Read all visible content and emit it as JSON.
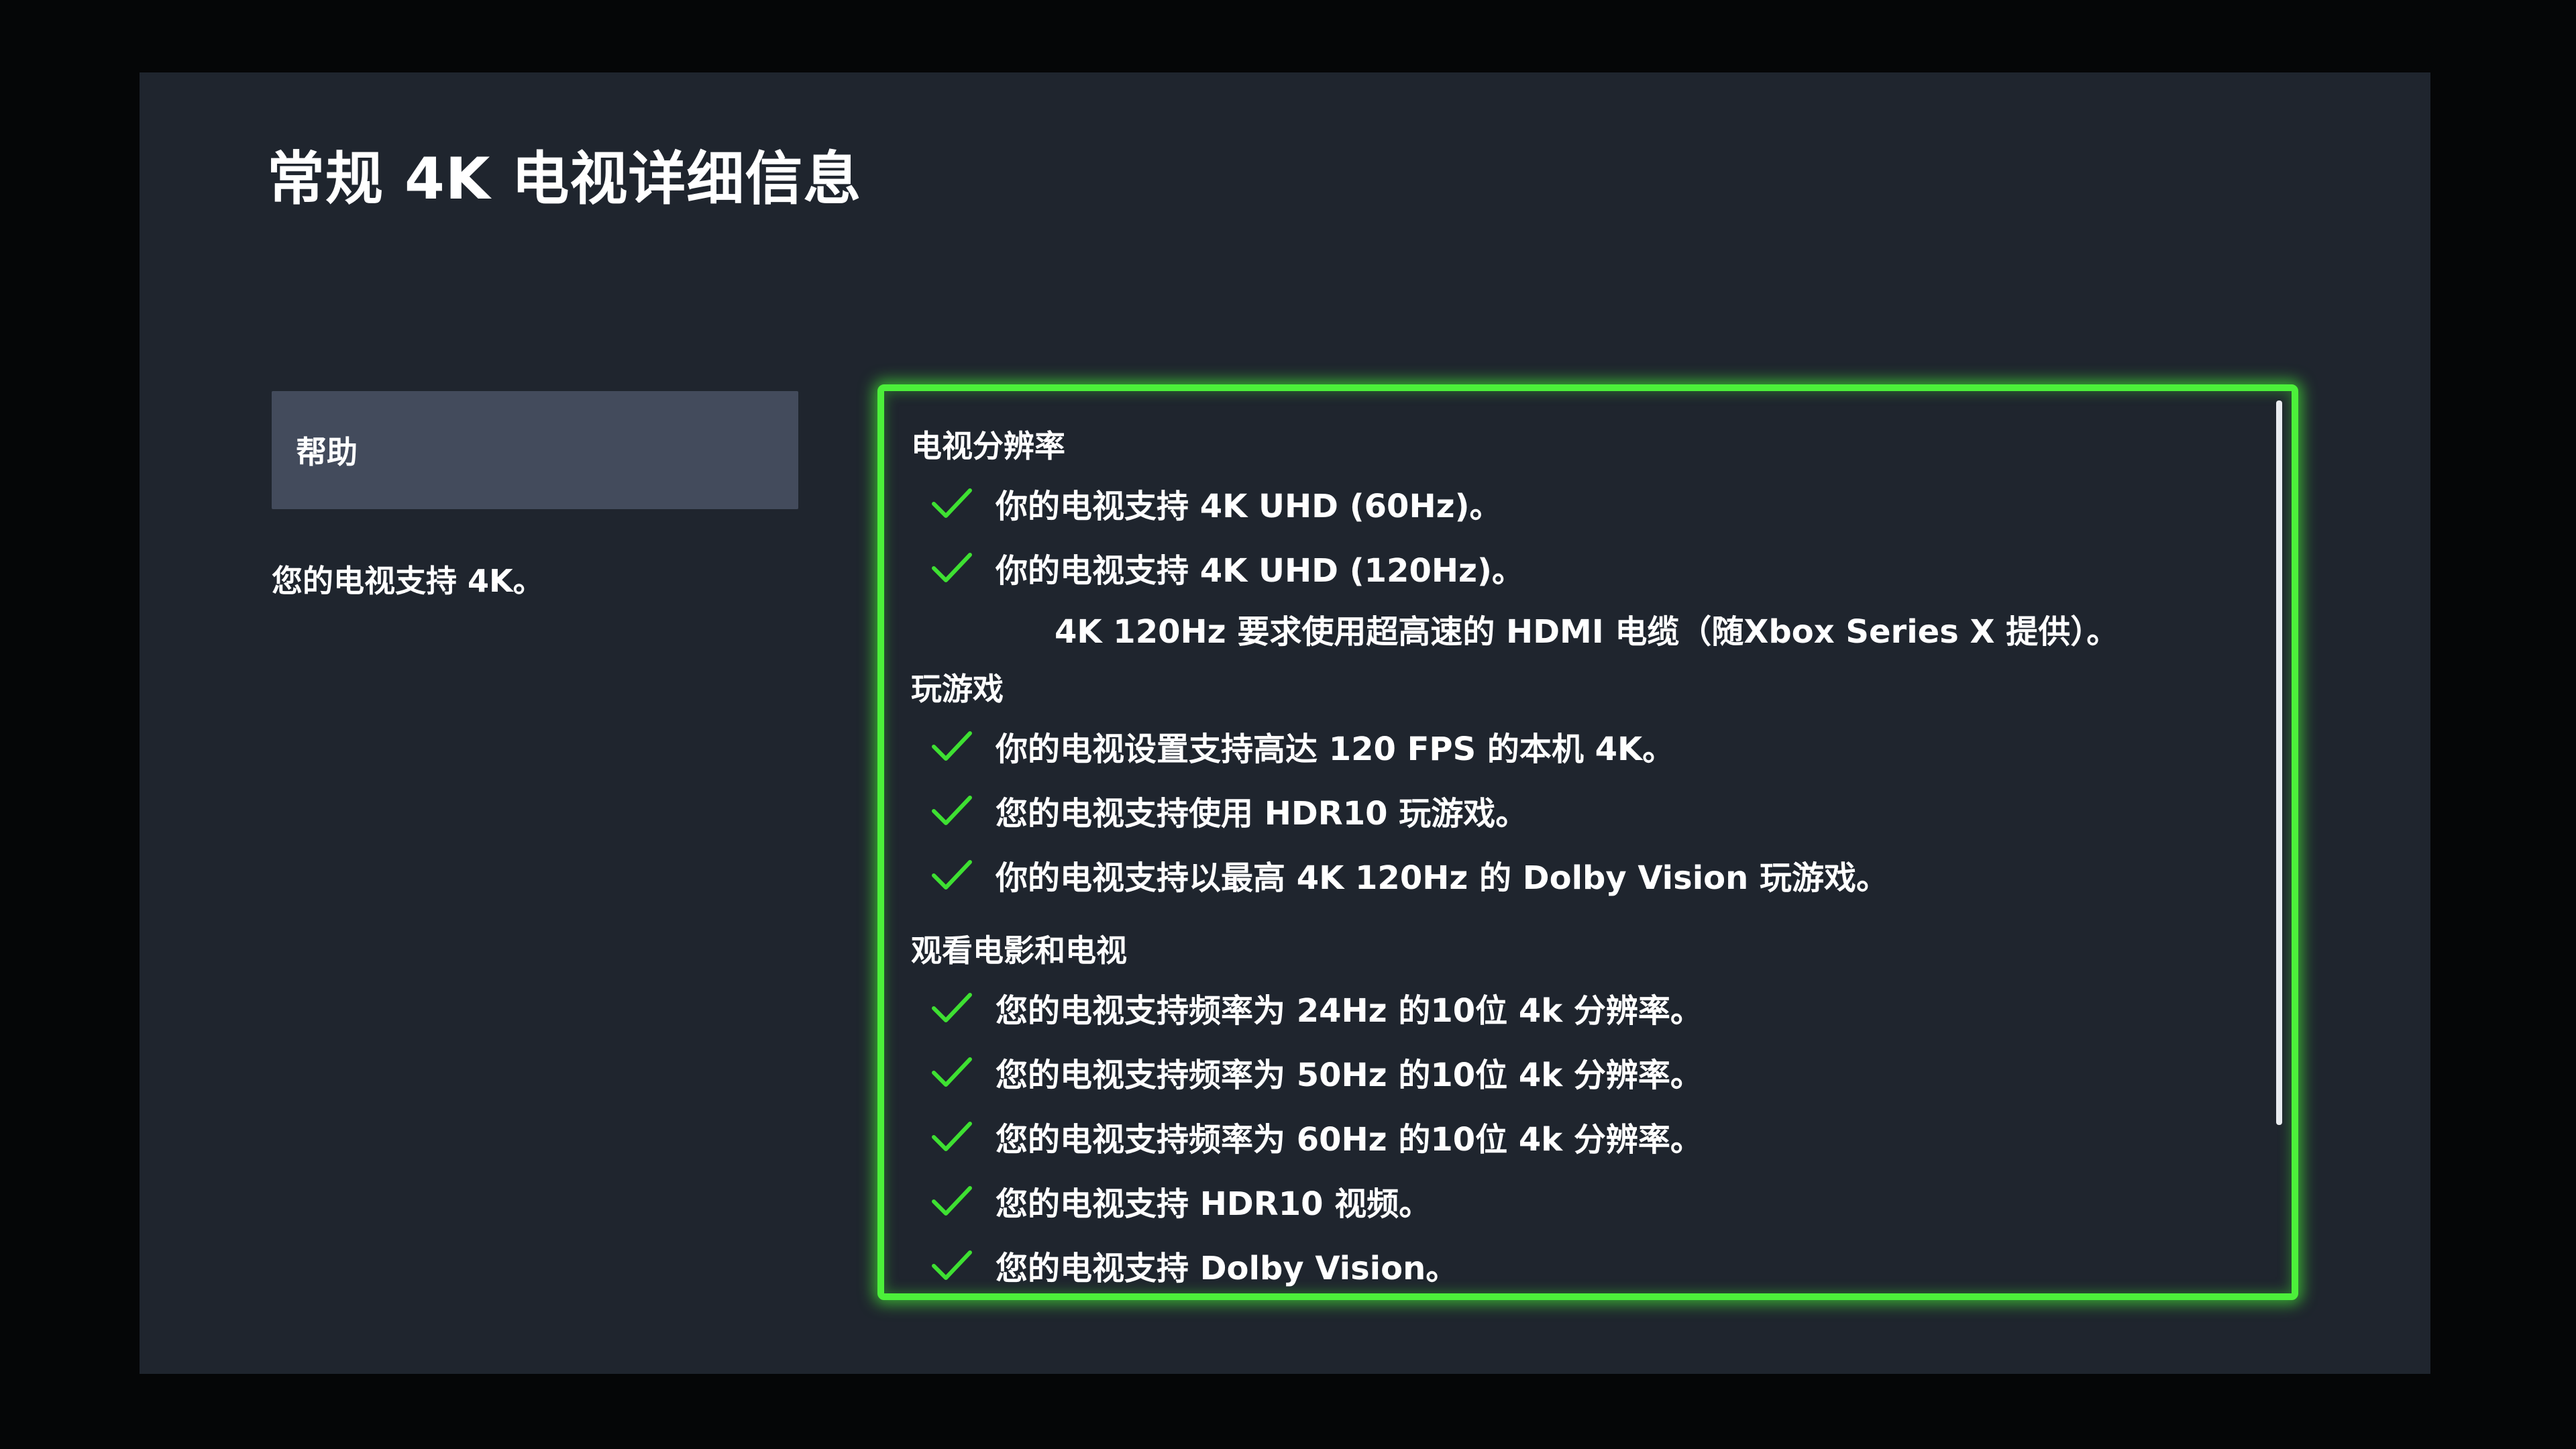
{
  "header": {
    "title": "常规 4K 电视详细信息"
  },
  "sidebar": {
    "help_label": "帮助",
    "description": "您的电视支持 4K。"
  },
  "details": {
    "sections": [
      {
        "heading": "电视分辨率",
        "items": [
          "你的电视支持 4K UHD (60Hz)。",
          "你的电视支持 4K UHD (120Hz)。"
        ],
        "note": "4K 120Hz 要求使用超高速的 HDMI 电缆（随Xbox Series X 提供）。"
      },
      {
        "heading": "玩游戏",
        "items": [
          "你的电视设置支持高达 120 FPS 的本机 4K。",
          "您的电视支持使用 HDR10 玩游戏。",
          "你的电视支持以最高 4K 120Hz 的 Dolby Vision 玩游戏。"
        ]
      },
      {
        "heading": "观看电影和电视",
        "items": [
          "您的电视支持频率为 24Hz 的10位 4k 分辨率。",
          "您的电视支持频率为 50Hz 的10位 4k 分辨率。",
          "您的电视支持频率为 60Hz 的10位 4k 分辨率。",
          "您的电视支持 HDR10 视频。",
          "您的电视支持 Dolby Vision。"
        ]
      }
    ]
  },
  "icons": {
    "check": "checkmark-icon"
  },
  "colors": {
    "background": "#1f252e",
    "focus_border": "#4cf03a",
    "check": "#3ee032",
    "button": "#434b5c"
  }
}
